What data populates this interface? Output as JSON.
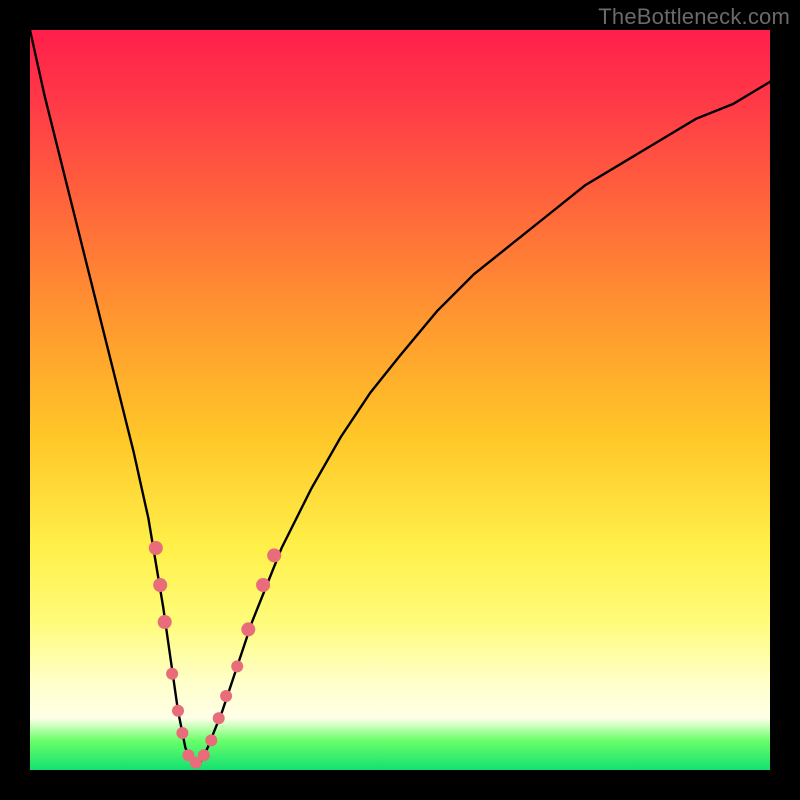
{
  "watermark": "TheBottleneck.com",
  "chart_data": {
    "type": "line",
    "title": "",
    "xlabel": "",
    "ylabel": "",
    "xlim": [
      0,
      100
    ],
    "ylim": [
      0,
      100
    ],
    "grid": false,
    "legend": false,
    "annotations": [],
    "series": [
      {
        "name": "curve",
        "x": [
          0,
          2,
          4,
          6,
          8,
          10,
          12,
          14,
          16,
          18,
          19,
          20,
          21,
          22,
          23,
          24,
          26,
          28,
          30,
          34,
          38,
          42,
          46,
          50,
          55,
          60,
          65,
          70,
          75,
          80,
          85,
          90,
          95,
          100
        ],
        "values": [
          100,
          91,
          83,
          75,
          67,
          59,
          51,
          43,
          34,
          22,
          15,
          8,
          3,
          1,
          1,
          3,
          8,
          14,
          20,
          30,
          38,
          45,
          51,
          56,
          62,
          67,
          71,
          75,
          79,
          82,
          85,
          88,
          90,
          93
        ]
      }
    ],
    "markers": [
      {
        "x": 17.0,
        "y": 30,
        "r": 7
      },
      {
        "x": 17.6,
        "y": 25,
        "r": 7
      },
      {
        "x": 18.2,
        "y": 20,
        "r": 7
      },
      {
        "x": 19.2,
        "y": 13,
        "r": 6
      },
      {
        "x": 20.0,
        "y": 8,
        "r": 6
      },
      {
        "x": 20.6,
        "y": 5,
        "r": 6
      },
      {
        "x": 21.4,
        "y": 2,
        "r": 6
      },
      {
        "x": 22.4,
        "y": 1,
        "r": 6
      },
      {
        "x": 23.5,
        "y": 2,
        "r": 6
      },
      {
        "x": 24.5,
        "y": 4,
        "r": 6
      },
      {
        "x": 25.5,
        "y": 7,
        "r": 6
      },
      {
        "x": 26.5,
        "y": 10,
        "r": 6
      },
      {
        "x": 28.0,
        "y": 14,
        "r": 6
      },
      {
        "x": 29.5,
        "y": 19,
        "r": 7
      },
      {
        "x": 31.5,
        "y": 25,
        "r": 7
      },
      {
        "x": 33.0,
        "y": 29,
        "r": 7
      }
    ]
  }
}
